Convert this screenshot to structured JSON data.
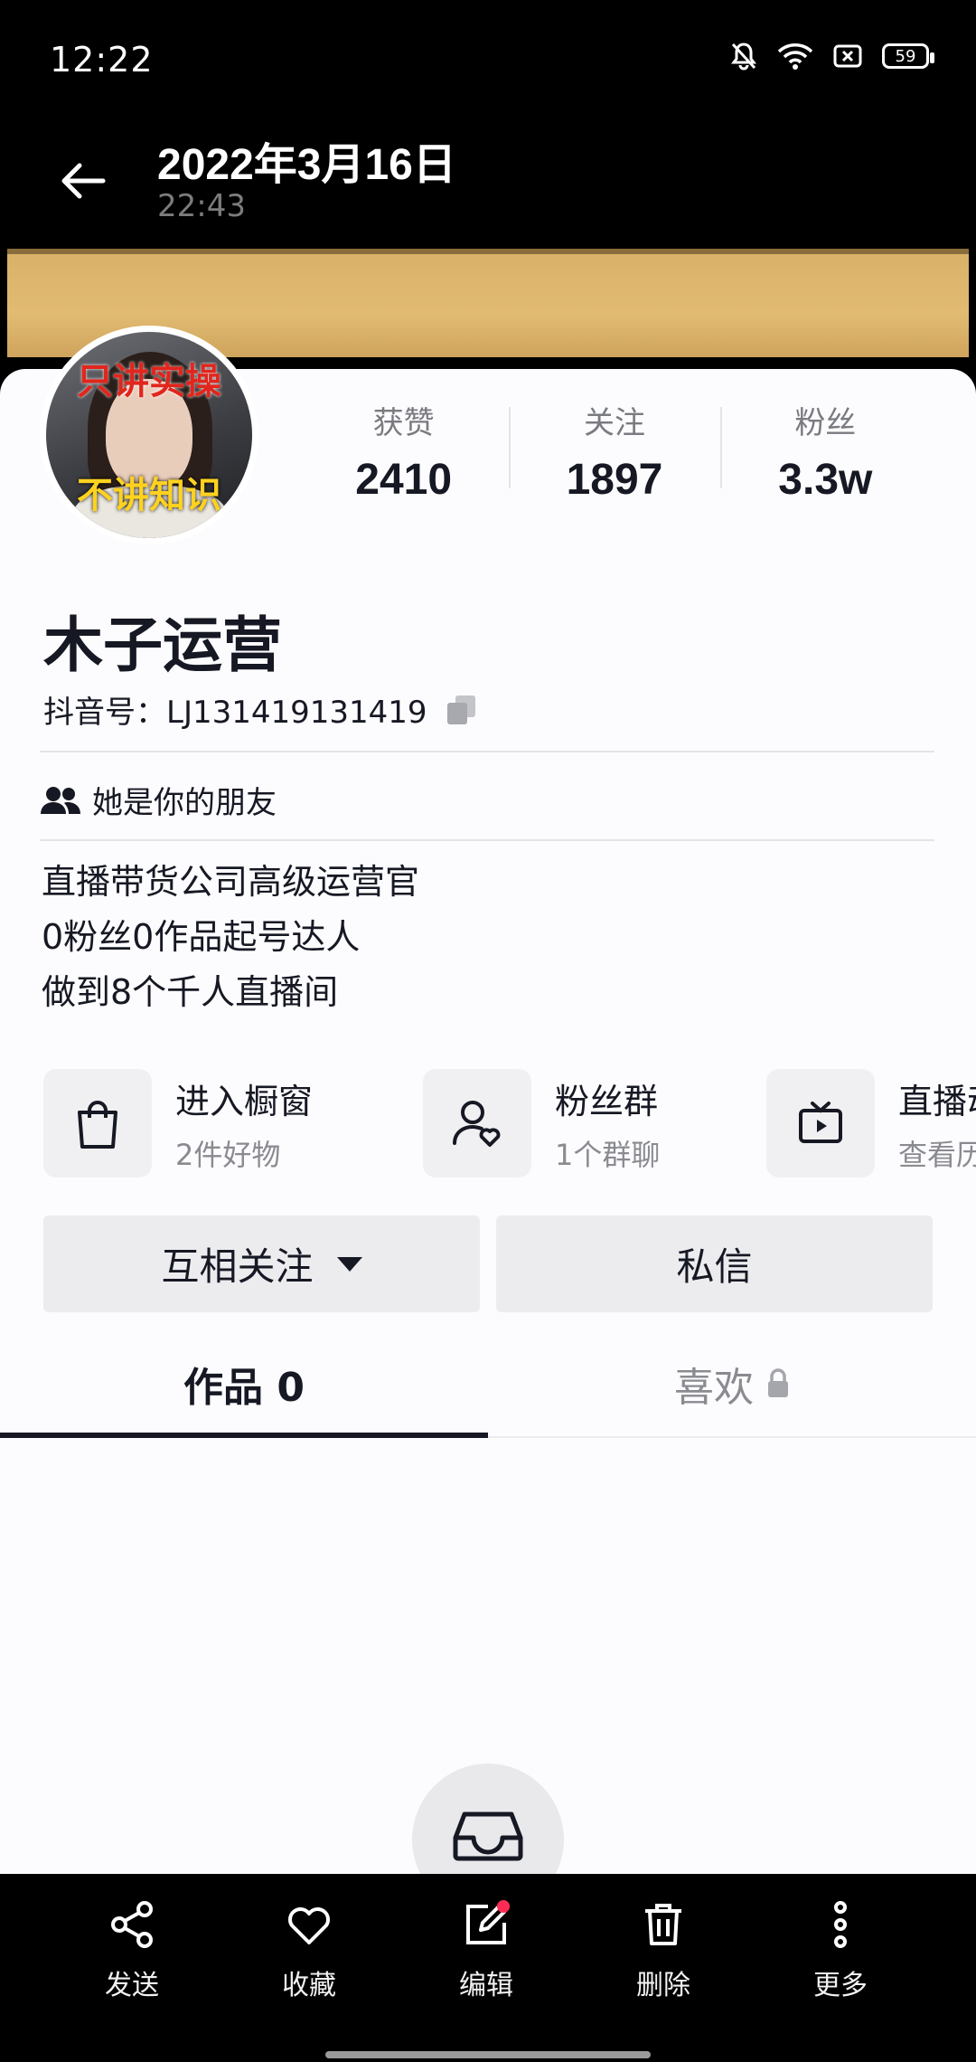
{
  "status_bar": {
    "time": "12:22",
    "battery": "59"
  },
  "header": {
    "date": "2022年3月16日",
    "time": "22:43"
  },
  "avatar": {
    "overlay_top": "只讲实操",
    "overlay_bottom": "不讲知识"
  },
  "stats": [
    {
      "label": "获赞",
      "value": "2410"
    },
    {
      "label": "关注",
      "value": "1897"
    },
    {
      "label": "粉丝",
      "value": "3.3w"
    }
  ],
  "profile": {
    "name": "木子运营",
    "douyin_id": "抖音号：LJ131419131419",
    "relation": "她是你的朋友",
    "bio": [
      "直播带货公司高级运营官",
      "0粉丝0作品起号达人",
      "做到8个千人直播间"
    ]
  },
  "shortcuts": [
    {
      "title": "进入橱窗",
      "sub": "2件好物",
      "icon": "shopping-bag-icon"
    },
    {
      "title": "粉丝群",
      "sub": "1个群聊",
      "icon": "user-heart-icon"
    },
    {
      "title": "直播动态",
      "sub": "查看历史直播",
      "icon": "tv-icon"
    }
  ],
  "buttons": {
    "follow": "互相关注",
    "message": "私信"
  },
  "tabs": {
    "works": "作品 0",
    "likes": "喜欢"
  },
  "actions": [
    {
      "label": "发送",
      "icon": "share-icon"
    },
    {
      "label": "收藏",
      "icon": "heart-icon"
    },
    {
      "label": "编辑",
      "icon": "edit-icon"
    },
    {
      "label": "删除",
      "icon": "trash-icon"
    },
    {
      "label": "更多",
      "icon": "more-icon"
    }
  ],
  "colors": {
    "accent_red": "#fe2c55",
    "text": "#161823",
    "muted": "#8a8b91"
  }
}
